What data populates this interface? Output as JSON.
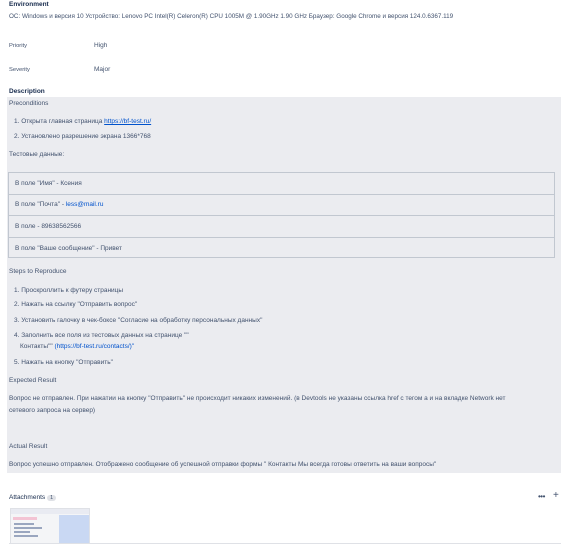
{
  "environment": {
    "heading": "Environment",
    "value": "ОС: Windows и версия 10 Устройство: Lenovo PC Intel(R) Celeron(R) CPU 1005M @ 1.90GHz 1.90 GHz Браузер: Google Chrome и версия 124.0.6367.119"
  },
  "fields": {
    "priority_label": "Priority",
    "priority_value": "High",
    "severity_label": "Severity",
    "severity_value": "Major"
  },
  "description": {
    "heading": "Description",
    "preconditions_title": "Preconditions",
    "preconditions": [
      {
        "num": "1.",
        "text": "Открыта главная страница ",
        "link": "https://bf-test.ru/"
      },
      {
        "num": "2.",
        "text": "Установлено разрешение экрана 1366*768",
        "link": ""
      }
    ],
    "test_data_title": "Тестовые данные:",
    "test_data_rows": [
      "В поле \"Имя\" - Ксения",
      "В поле \"Почта\" - ",
      "В поле  - 89638562566",
      "В поле \"Ваше сообщение\" - Привет"
    ],
    "email_link": "less@mail.ru",
    "steps_title": "Steps to Reproduce",
    "steps": [
      {
        "num": "1.",
        "text": "Проскроллить к футеру страницы"
      },
      {
        "num": "2.",
        "text": "Нажать на ссылку \"Отправить вопрос\""
      },
      {
        "num": "3.",
        "text": "Установить галочку в чек-боксе \"Согласие на обработку персональных данных\""
      },
      {
        "num": "4.",
        "text": "Заполнить все поля из тестовых данных на странице \"\""
      },
      {
        "num": "5.",
        "text": "Нажать на кнопку \"Отправить\""
      }
    ],
    "step4_cont_text": "Контакты\"\" ",
    "step4_cont_link": "(https://bf-test.ru/contacts/)\"",
    "expected_title": "Expected Result",
    "expected_text_1": "Вопрос не отправлен. При нажатии на кнопку \"Отправить\" не происходит никаких изменений. (в Devtools не указаны ссылка href с тегом a и на вкладке Network нет",
    "expected_text_2": "сетевого запроса на сервер)",
    "actual_title": "Actual Result",
    "actual_text": "Вопрос успешно отправлен. Отображено сообщение об успешной отправки формы \" Контакты Мы всегда готовы ответить на ваши вопросы\""
  },
  "attachments": {
    "title": "Attachments",
    "count": "1",
    "more_icon": "more-dots-icon",
    "add_icon": "plus-icon"
  }
}
